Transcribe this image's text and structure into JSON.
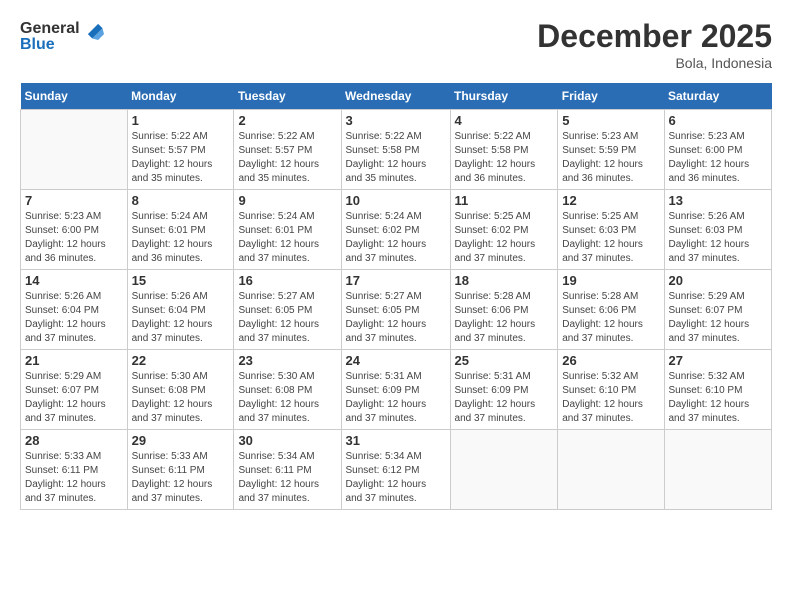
{
  "header": {
    "logo_general": "General",
    "logo_blue": "Blue",
    "month_title": "December 2025",
    "location": "Bola, Indonesia"
  },
  "days_of_week": [
    "Sunday",
    "Monday",
    "Tuesday",
    "Wednesday",
    "Thursday",
    "Friday",
    "Saturday"
  ],
  "weeks": [
    [
      {
        "day": "",
        "info": ""
      },
      {
        "day": "1",
        "info": "Sunrise: 5:22 AM\nSunset: 5:57 PM\nDaylight: 12 hours\nand 35 minutes."
      },
      {
        "day": "2",
        "info": "Sunrise: 5:22 AM\nSunset: 5:57 PM\nDaylight: 12 hours\nand 35 minutes."
      },
      {
        "day": "3",
        "info": "Sunrise: 5:22 AM\nSunset: 5:58 PM\nDaylight: 12 hours\nand 35 minutes."
      },
      {
        "day": "4",
        "info": "Sunrise: 5:22 AM\nSunset: 5:58 PM\nDaylight: 12 hours\nand 36 minutes."
      },
      {
        "day": "5",
        "info": "Sunrise: 5:23 AM\nSunset: 5:59 PM\nDaylight: 12 hours\nand 36 minutes."
      },
      {
        "day": "6",
        "info": "Sunrise: 5:23 AM\nSunset: 6:00 PM\nDaylight: 12 hours\nand 36 minutes."
      }
    ],
    [
      {
        "day": "7",
        "info": "Sunrise: 5:23 AM\nSunset: 6:00 PM\nDaylight: 12 hours\nand 36 minutes."
      },
      {
        "day": "8",
        "info": "Sunrise: 5:24 AM\nSunset: 6:01 PM\nDaylight: 12 hours\nand 36 minutes."
      },
      {
        "day": "9",
        "info": "Sunrise: 5:24 AM\nSunset: 6:01 PM\nDaylight: 12 hours\nand 37 minutes."
      },
      {
        "day": "10",
        "info": "Sunrise: 5:24 AM\nSunset: 6:02 PM\nDaylight: 12 hours\nand 37 minutes."
      },
      {
        "day": "11",
        "info": "Sunrise: 5:25 AM\nSunset: 6:02 PM\nDaylight: 12 hours\nand 37 minutes."
      },
      {
        "day": "12",
        "info": "Sunrise: 5:25 AM\nSunset: 6:03 PM\nDaylight: 12 hours\nand 37 minutes."
      },
      {
        "day": "13",
        "info": "Sunrise: 5:26 AM\nSunset: 6:03 PM\nDaylight: 12 hours\nand 37 minutes."
      }
    ],
    [
      {
        "day": "14",
        "info": "Sunrise: 5:26 AM\nSunset: 6:04 PM\nDaylight: 12 hours\nand 37 minutes."
      },
      {
        "day": "15",
        "info": "Sunrise: 5:26 AM\nSunset: 6:04 PM\nDaylight: 12 hours\nand 37 minutes."
      },
      {
        "day": "16",
        "info": "Sunrise: 5:27 AM\nSunset: 6:05 PM\nDaylight: 12 hours\nand 37 minutes."
      },
      {
        "day": "17",
        "info": "Sunrise: 5:27 AM\nSunset: 6:05 PM\nDaylight: 12 hours\nand 37 minutes."
      },
      {
        "day": "18",
        "info": "Sunrise: 5:28 AM\nSunset: 6:06 PM\nDaylight: 12 hours\nand 37 minutes."
      },
      {
        "day": "19",
        "info": "Sunrise: 5:28 AM\nSunset: 6:06 PM\nDaylight: 12 hours\nand 37 minutes."
      },
      {
        "day": "20",
        "info": "Sunrise: 5:29 AM\nSunset: 6:07 PM\nDaylight: 12 hours\nand 37 minutes."
      }
    ],
    [
      {
        "day": "21",
        "info": "Sunrise: 5:29 AM\nSunset: 6:07 PM\nDaylight: 12 hours\nand 37 minutes."
      },
      {
        "day": "22",
        "info": "Sunrise: 5:30 AM\nSunset: 6:08 PM\nDaylight: 12 hours\nand 37 minutes."
      },
      {
        "day": "23",
        "info": "Sunrise: 5:30 AM\nSunset: 6:08 PM\nDaylight: 12 hours\nand 37 minutes."
      },
      {
        "day": "24",
        "info": "Sunrise: 5:31 AM\nSunset: 6:09 PM\nDaylight: 12 hours\nand 37 minutes."
      },
      {
        "day": "25",
        "info": "Sunrise: 5:31 AM\nSunset: 6:09 PM\nDaylight: 12 hours\nand 37 minutes."
      },
      {
        "day": "26",
        "info": "Sunrise: 5:32 AM\nSunset: 6:10 PM\nDaylight: 12 hours\nand 37 minutes."
      },
      {
        "day": "27",
        "info": "Sunrise: 5:32 AM\nSunset: 6:10 PM\nDaylight: 12 hours\nand 37 minutes."
      }
    ],
    [
      {
        "day": "28",
        "info": "Sunrise: 5:33 AM\nSunset: 6:11 PM\nDaylight: 12 hours\nand 37 minutes."
      },
      {
        "day": "29",
        "info": "Sunrise: 5:33 AM\nSunset: 6:11 PM\nDaylight: 12 hours\nand 37 minutes."
      },
      {
        "day": "30",
        "info": "Sunrise: 5:34 AM\nSunset: 6:11 PM\nDaylight: 12 hours\nand 37 minutes."
      },
      {
        "day": "31",
        "info": "Sunrise: 5:34 AM\nSunset: 6:12 PM\nDaylight: 12 hours\nand 37 minutes."
      },
      {
        "day": "",
        "info": ""
      },
      {
        "day": "",
        "info": ""
      },
      {
        "day": "",
        "info": ""
      }
    ]
  ]
}
